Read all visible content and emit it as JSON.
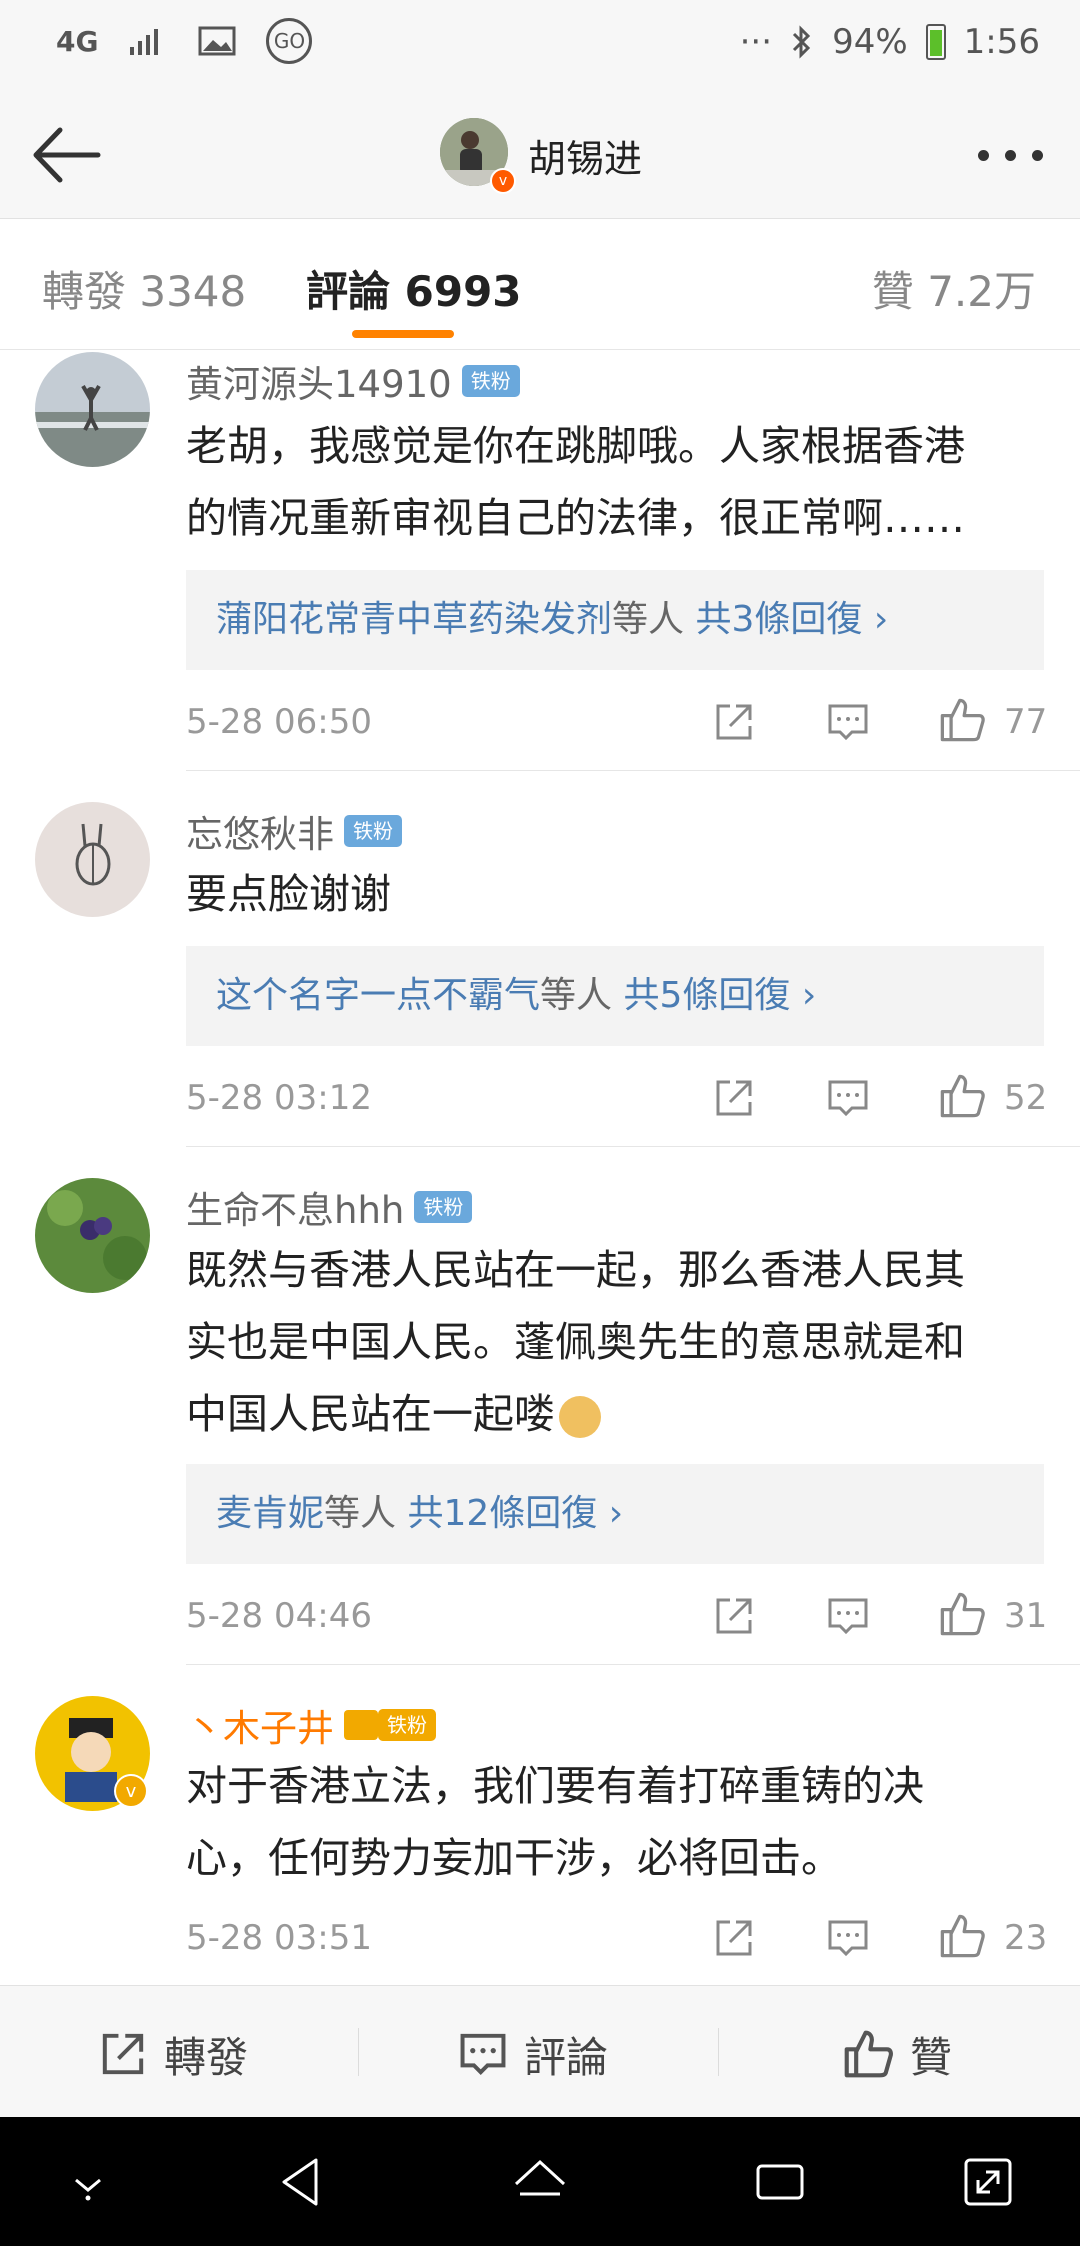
{
  "status_bar": {
    "network": "4G",
    "battery": "94%",
    "time": "1:56",
    "dots": "···",
    "go_label": "GO"
  },
  "header": {
    "title": "胡锡进"
  },
  "tabs": {
    "repost": "轉發 3348",
    "comments": "評論 6993",
    "likes": "贊 7.2万"
  },
  "fan_badge": "铁粉",
  "comments": [
    {
      "name": "黄河源头14910",
      "text_lines": [
        "老胡，我感觉是你在跳脚哦。人家根据香港",
        "的情况重新审视自己的法律，很正常啊……"
      ],
      "reply": {
        "user": "蒲阳花常青中草药染发剂",
        "suffix": "等人",
        "count": "共3條回復 ›"
      },
      "time": "5-28 06:50",
      "likes": "77"
    },
    {
      "name": "忘悠秋非",
      "text_lines": [
        "要点脸谢谢"
      ],
      "reply": {
        "user": "这个名字一点不霸气",
        "suffix": "等人",
        "count": "共5條回復 ›"
      },
      "time": "5-28 03:12",
      "likes": "52"
    },
    {
      "name": "生命不息hhh",
      "text_lines": [
        "既然与香港人民站在一起，那么香港人民其",
        "实也是中国人民。蓬佩奥先生的意思就是和",
        "中国人民站在一起喽"
      ],
      "reply": {
        "user": "麦肯妮",
        "suffix": "等人",
        "count": "共12條回復 ›"
      },
      "time": "5-28 04:46",
      "likes": "31"
    },
    {
      "name": "丶木子井",
      "text_lines": [
        "对于香港立法，我们要有着打碎重铸的决",
        "心，任何势力妄加干涉，必将回击。"
      ],
      "time": "5-28 03:51",
      "likes": "23"
    }
  ],
  "bottom_bar": {
    "repost": "轉發",
    "comment": "評論",
    "like": "贊"
  },
  "colors": {
    "accent": "#ff8200",
    "link": "#4a7cb3",
    "fan_badge": "#6aa8dc"
  }
}
